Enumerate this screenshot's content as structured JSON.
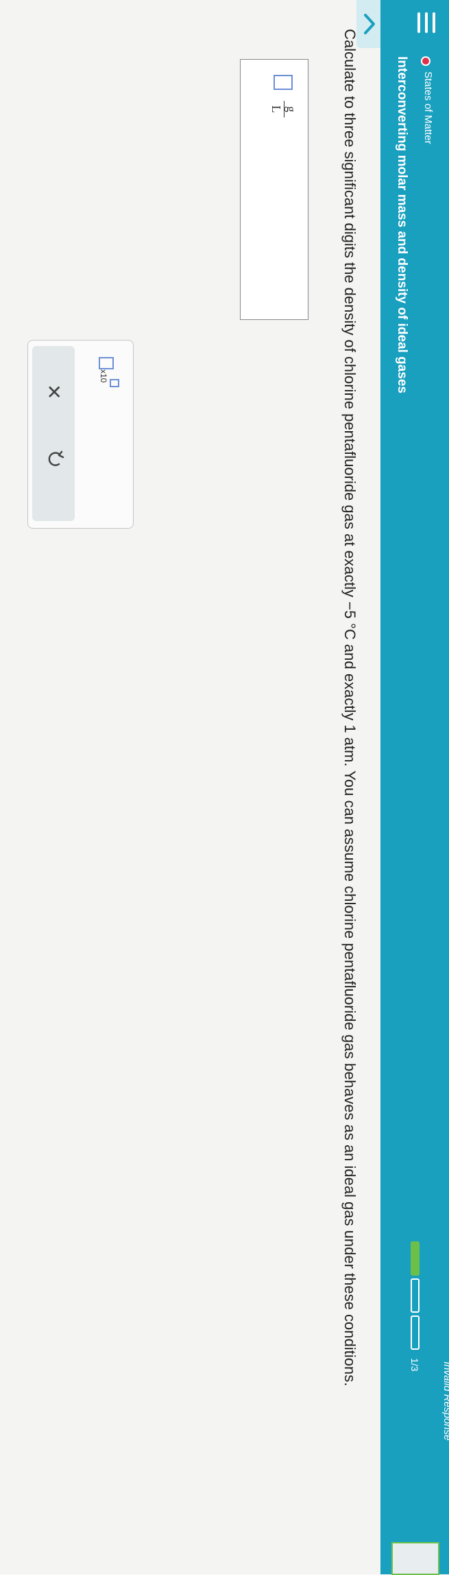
{
  "header": {
    "topic": "States of Matter",
    "title": "Interconverting molar mass and density of ideal gases",
    "progress_text": "1/3",
    "progress": {
      "completed": 1,
      "total": 3
    },
    "right_partial_text": "Invalid Response",
    "colors": {
      "bar": "#1aa0bf",
      "progress_done": "#6cc04a",
      "topic_dot": "#e0304a"
    }
  },
  "question": {
    "text": "Calculate to three significant digits the density of chlorine pentafluoride gas at exactly −5 °C and exactly 1 atm. You can assume chlorine pentafluoride gas behaves as an ideal gas under these conditions."
  },
  "answer": {
    "value": "",
    "unit_numerator": "g",
    "unit_denominator": "L"
  },
  "tools": {
    "x10_label": "x10",
    "clear_icon": "close-icon",
    "undo_icon": "undo-icon",
    "clear_symbol": "✕"
  },
  "icons": {
    "menu": "menu-icon",
    "collapse": "chevron-up-icon"
  }
}
